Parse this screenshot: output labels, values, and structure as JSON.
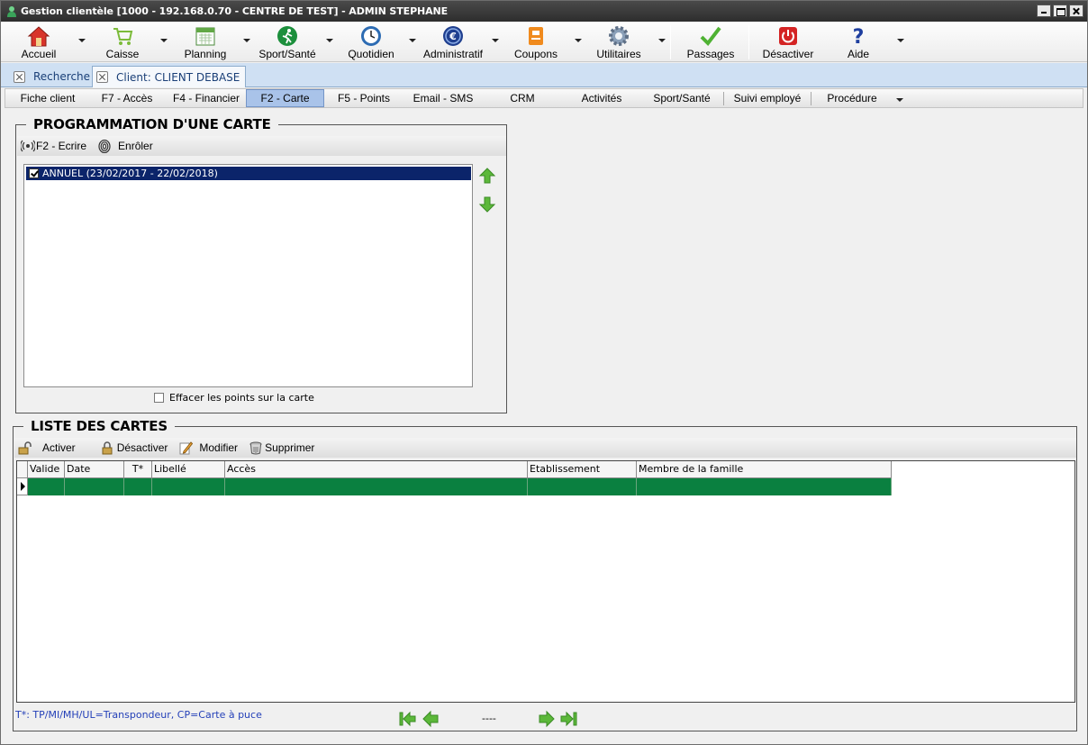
{
  "window": {
    "title": "Gestion clientèle [1000 - 192.168.0.70 - CENTRE DE TEST] - ADMIN STEPHANE"
  },
  "toolbar": {
    "items": [
      {
        "label": "Accueil",
        "icon": "home-icon"
      },
      {
        "label": "Caisse",
        "icon": "cart-icon"
      },
      {
        "label": "Planning",
        "icon": "calendar-icon"
      },
      {
        "label": "Sport/Santé",
        "icon": "runner-icon"
      },
      {
        "label": "Quotidien",
        "icon": "clock-icon"
      },
      {
        "label": "Administratif",
        "icon": "euro-icon"
      },
      {
        "label": "Coupons",
        "icon": "coupon-icon"
      },
      {
        "label": "Utilitaires",
        "icon": "gear-icon"
      },
      {
        "label": "Passages",
        "icon": "checkmark-icon"
      },
      {
        "label": "Désactiver",
        "icon": "power-icon"
      },
      {
        "label": "Aide",
        "icon": "help-icon"
      }
    ]
  },
  "doc_tabs": [
    {
      "label": "Recherche"
    },
    {
      "label": "Client: CLIENT DEBASE"
    }
  ],
  "section_tabs": [
    {
      "label": "Fiche client"
    },
    {
      "label": "F7 - Accès"
    },
    {
      "label": "F4 - Financier"
    },
    {
      "label": "F2 - Carte"
    },
    {
      "label": "F5 - Points"
    },
    {
      "label": "Email - SMS"
    },
    {
      "label": "CRM"
    },
    {
      "label": "Activités"
    },
    {
      "label": "Sport/Santé"
    },
    {
      "label": "Suivi employé"
    },
    {
      "label": "Procédure"
    }
  ],
  "programmation": {
    "title": "PROGRAMMATION D'UNE CARTE",
    "write_label": "F2 - Ecrire",
    "enroll_label": "Enrôler",
    "items": [
      {
        "label": "ANNUEL (23/02/2017 - 22/02/2018)",
        "checked": true
      }
    ],
    "erase_label": "Effacer les points sur la carte",
    "erase_checked": false
  },
  "cards": {
    "title": "LISTE DES CARTES",
    "actions": {
      "activate": "Activer",
      "deactivate": "Désactiver",
      "edit": "Modifier",
      "delete": "Supprimer"
    },
    "columns": [
      "Valide",
      "Date",
      "T*",
      "Libellé",
      "Accès",
      "Etablissement",
      "Membre de la famille"
    ],
    "footnote": "T*: TP/MI/MH/UL=Transpondeur, CP=Carte à puce",
    "page_indicator": "----"
  },
  "colors": {
    "selected_row": "#0b246a",
    "grid_row": "#0a8040",
    "active_tab": "#a9c3e9",
    "doc_tabs_bg": "#cfe0f3"
  }
}
